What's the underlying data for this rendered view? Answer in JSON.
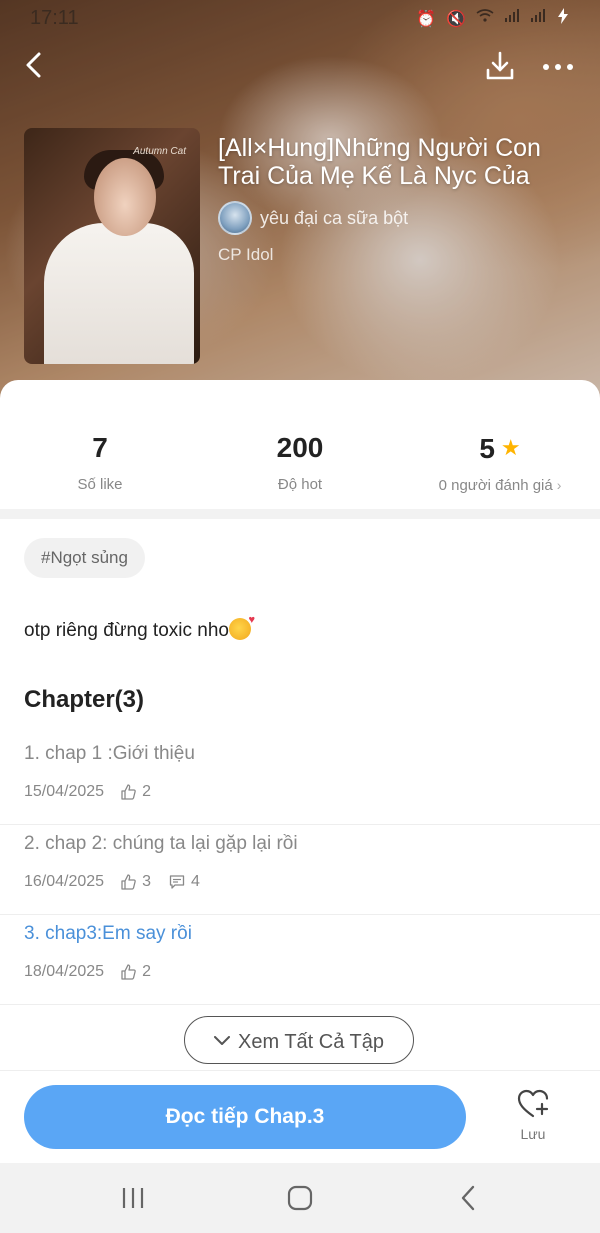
{
  "status_bar": {
    "time": "17:11",
    "icons": [
      "alarm-icon",
      "mute-icon",
      "wifi-icon",
      "signal-icon",
      "signal-icon",
      "battery-charging-icon"
    ]
  },
  "header": {
    "back_icon": "back-arrow-icon",
    "download_icon": "download-icon",
    "more_icon": "more-dots-icon"
  },
  "story": {
    "title": "[All×Hung]Những Người Con Trai Của Mẹ Kế Là Nyc Của",
    "author": "yêu đại ca sữa bột",
    "category": "CP Idol",
    "cover_signature": "Autumn Cat"
  },
  "stats": [
    {
      "value": "7",
      "label": "Số like"
    },
    {
      "value": "200",
      "label": "Độ hot"
    },
    {
      "value": "5",
      "label": "0 người đánh giá"
    }
  ],
  "tag": "#Ngọt sủng",
  "description": "otp riêng đừng toxic nho",
  "chapters_heading": "Chapter(3)",
  "chapters": [
    {
      "title": "1. chap 1 :Giới thiệu",
      "date": "15/04/2025",
      "likes": "2",
      "comments": ""
    },
    {
      "title": "2. chap 2: chúng ta lại gặp lại rồi",
      "date": "16/04/2025",
      "likes": "3",
      "comments": "4"
    },
    {
      "title": "3. chap3:Em say rồi",
      "date": "18/04/2025",
      "likes": "2",
      "comments": ""
    }
  ],
  "see_all_label": "Xem Tất Cả Tập",
  "action_bar": {
    "read_label": "Đọc tiếp Chap.3",
    "save_label": "Lưu"
  },
  "colors": {
    "accent": "#5aa6f5",
    "active_chapter": "#4a90d9",
    "star": "#ffb400"
  }
}
